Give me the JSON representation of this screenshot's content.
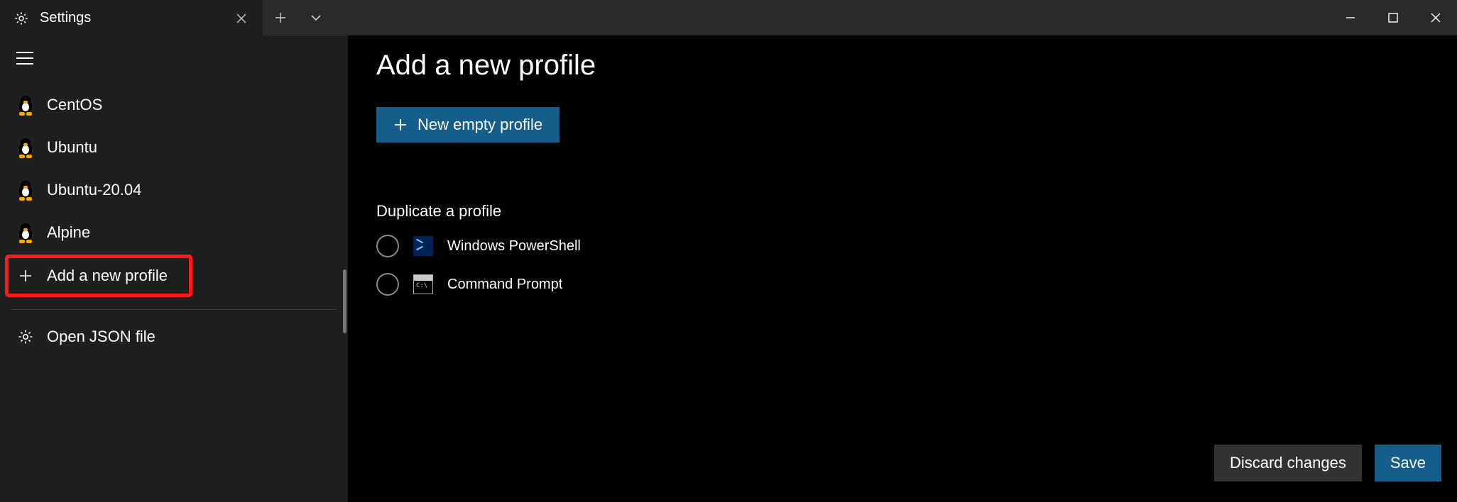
{
  "tab": {
    "title": "Settings"
  },
  "sidebar": {
    "items": [
      {
        "label": "CentOS"
      },
      {
        "label": "Ubuntu"
      },
      {
        "label": "Ubuntu-20.04"
      },
      {
        "label": "Alpine"
      }
    ],
    "add_label": "Add a new profile",
    "open_json_label": "Open JSON file"
  },
  "main": {
    "title": "Add a new profile",
    "new_empty_label": "New empty profile",
    "duplicate_label": "Duplicate a profile",
    "profiles": [
      {
        "label": "Windows PowerShell"
      },
      {
        "label": "Command Prompt"
      }
    ],
    "discard_label": "Discard changes",
    "save_label": "Save"
  }
}
